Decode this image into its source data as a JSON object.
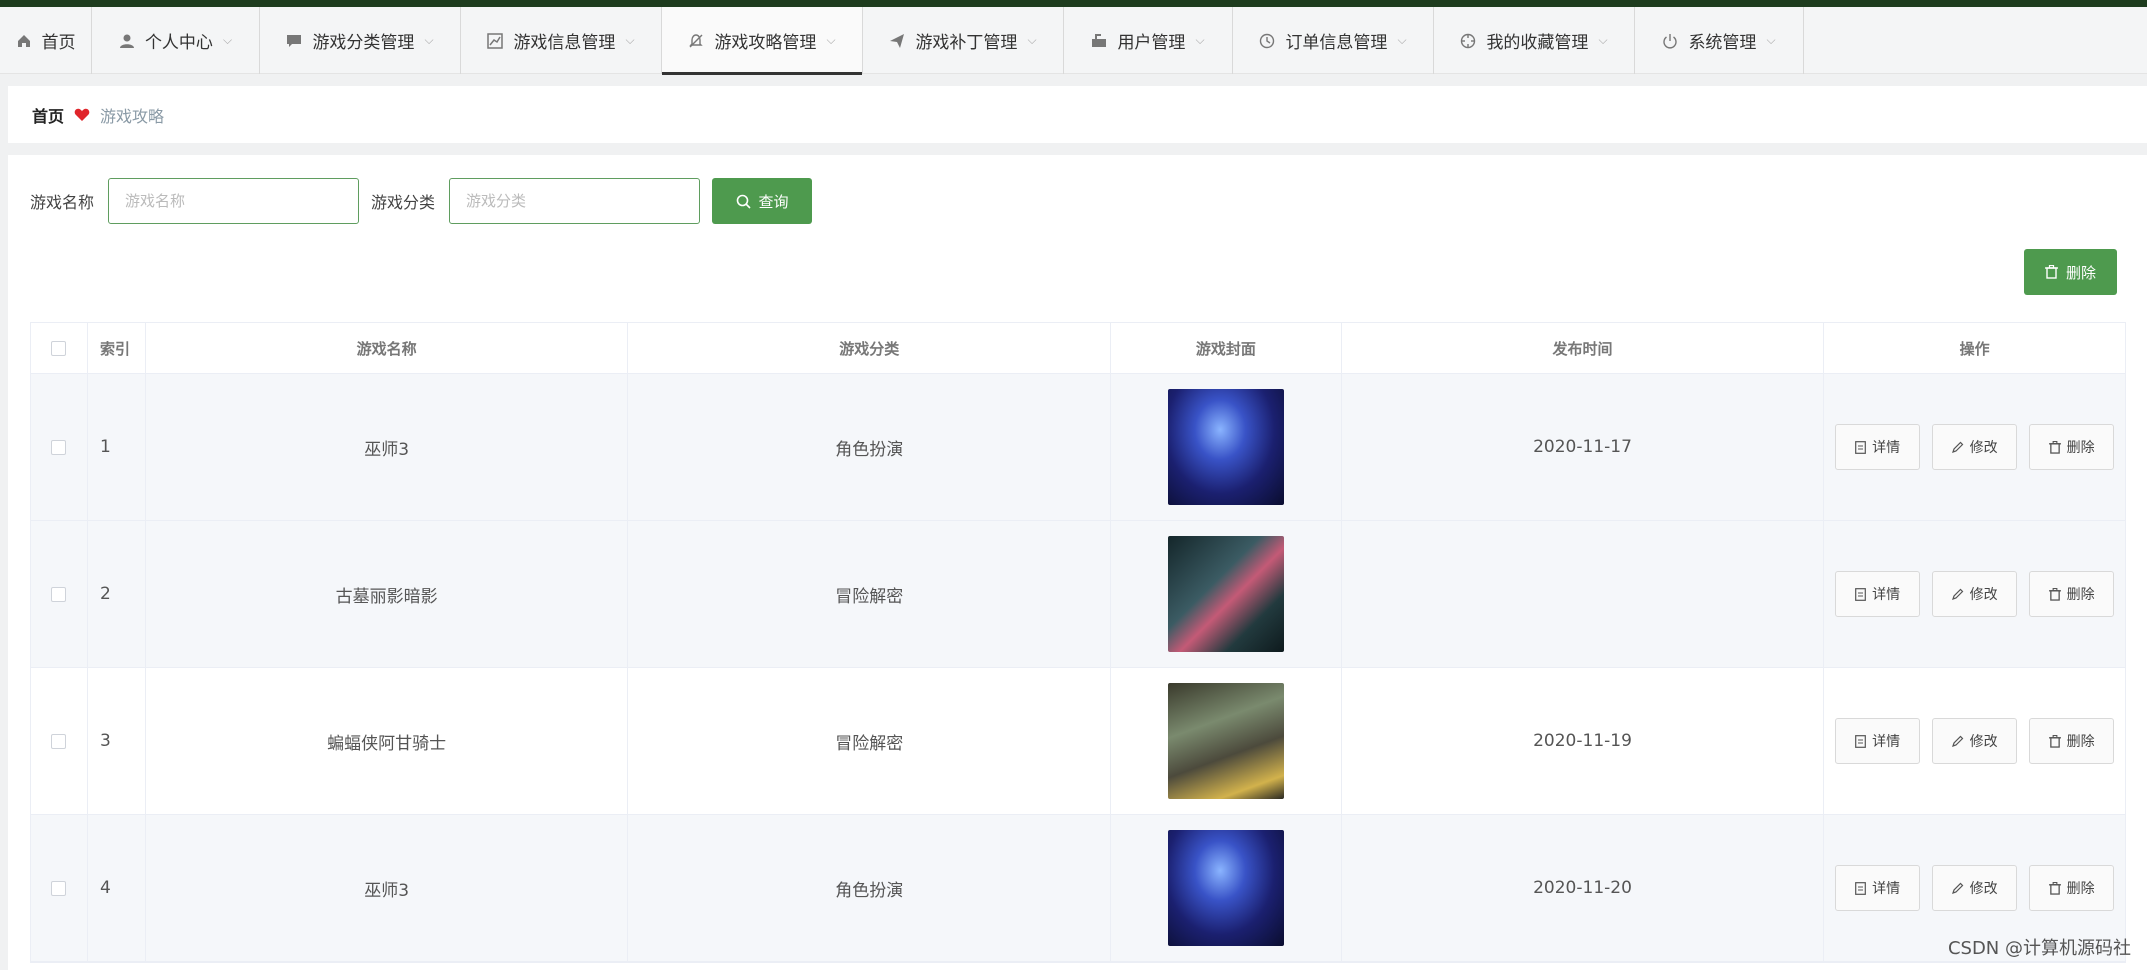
{
  "nav": {
    "items": [
      {
        "label": "首页",
        "icon": "home-icon"
      },
      {
        "label": "个人中心",
        "icon": "user-icon"
      },
      {
        "label": "游戏分类管理",
        "icon": "chat-icon"
      },
      {
        "label": "游戏信息管理",
        "icon": "chart-icon"
      },
      {
        "label": "游戏攻略管理",
        "icon": "bell-off-icon"
      },
      {
        "label": "游戏补丁管理",
        "icon": "send-icon"
      },
      {
        "label": "用户管理",
        "icon": "mailbox-icon"
      },
      {
        "label": "订单信息管理",
        "icon": "clock-icon"
      },
      {
        "label": "我的收藏管理",
        "icon": "aim-icon"
      },
      {
        "label": "系统管理",
        "icon": "power-icon"
      }
    ]
  },
  "breadcrumb": {
    "home": "首页",
    "current": "游戏攻略"
  },
  "search": {
    "name_label": "游戏名称",
    "name_placeholder": "游戏名称",
    "category_label": "游戏分类",
    "category_placeholder": "游戏分类",
    "query_label": "查询"
  },
  "toolbar": {
    "delete_label": "删除"
  },
  "table": {
    "headers": {
      "index": "索引",
      "name": "游戏名称",
      "category": "游戏分类",
      "cover": "游戏封面",
      "date": "发布时间",
      "ops": "操作"
    },
    "rows": [
      {
        "index": "1",
        "name": "巫师3",
        "category": "角色扮演",
        "cover": "blue",
        "date": "2020-11-17"
      },
      {
        "index": "2",
        "name": "古墓丽影暗影",
        "category": "冒险解密",
        "cover": "city",
        "date": ""
      },
      {
        "index": "3",
        "name": "蝙蝠侠阿甘骑士",
        "category": "冒险解密",
        "cover": "train",
        "date": "2020-11-19"
      },
      {
        "index": "4",
        "name": "巫师3",
        "category": "角色扮演",
        "cover": "blue",
        "date": "2020-11-20"
      }
    ],
    "actions": {
      "detail": "详情",
      "edit": "修改",
      "delete": "删除"
    }
  },
  "watermark": "CSDN @计算机源码社",
  "colors": {
    "accent": "#4e9a4e",
    "topbar": "#1e3c1e",
    "breadcrumb_heart": "#e0252b"
  }
}
